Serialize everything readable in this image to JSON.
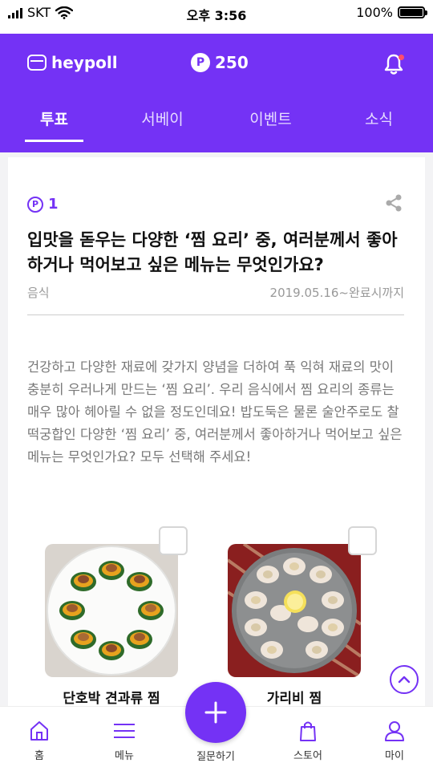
{
  "status_bar": {
    "carrier": "SKT",
    "time": "오후 3:56",
    "battery": "100%"
  },
  "header": {
    "logo_text": "heypoll",
    "points": "250",
    "point_symbol": "P",
    "accent_color": "#7432f5"
  },
  "tabs": [
    {
      "label": "투표",
      "active": true
    },
    {
      "label": "서베이",
      "active": false
    },
    {
      "label": "이벤트",
      "active": false
    },
    {
      "label": "소식",
      "active": false
    }
  ],
  "poll": {
    "reward_symbol": "P",
    "reward": "1",
    "title": "입맛을 돋우는 다양한 ‘찜 요리’ 중, 여러분께서 좋아하거나 먹어보고 싶은 메뉴는 무엇인가요?",
    "category": "음식",
    "period": "2019.05.16~완료시까지",
    "description": "건강하고 다양한 재료에 갖가지 양념을 더하여 푹 익혀 재료의 맛이 충분히 우러나게 만드는 ‘찜 요리’. 우리 음식에서 찜 요리의 종류는 매우 많아 헤아릴 수 없을 정도인데요! 밥도둑은 물론 술안주로도 찰떡궁합인 다양한 ‘찜 요리’ 중, 여러분께서 좋아하거나 먹어보고 싶은 메뉴는 무엇인가요? 모두 선택해 주세요!",
    "options": [
      {
        "label": "단호박 견과류 찜",
        "checked": false
      },
      {
        "label": "가리비 찜",
        "checked": false
      }
    ]
  },
  "bottom_nav": {
    "home": "홈",
    "menu": "메뉴",
    "ask": "질문하기",
    "store": "스토어",
    "my": "마이"
  }
}
